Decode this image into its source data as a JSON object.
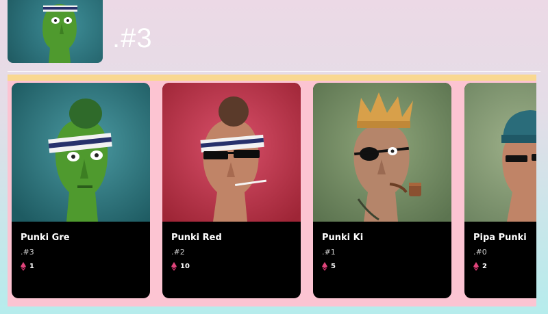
{
  "hero": {
    "title": ".#3",
    "image_icon": "punk-head-green-icon"
  },
  "colors": {
    "strip": "#fcc4d2",
    "strip_top": "#f9d890",
    "card_bg": "#000000",
    "eth_icon": "#e0447b"
  },
  "cards": [
    {
      "name": "Punki Gre",
      "id": ".#3",
      "price": "1",
      "image_icon": "punk-green-headband-icon"
    },
    {
      "name": "Punki Red",
      "id": ".#2",
      "price": "10",
      "image_icon": "punk-sunglasses-icon"
    },
    {
      "name": "Punki Ki",
      "id": ".#1",
      "price": "5",
      "image_icon": "punk-crown-pipe-icon"
    },
    {
      "name": "Pipa Punki",
      "id": ".#0",
      "price": "2",
      "image_icon": "punk-beanie-icon"
    }
  ]
}
